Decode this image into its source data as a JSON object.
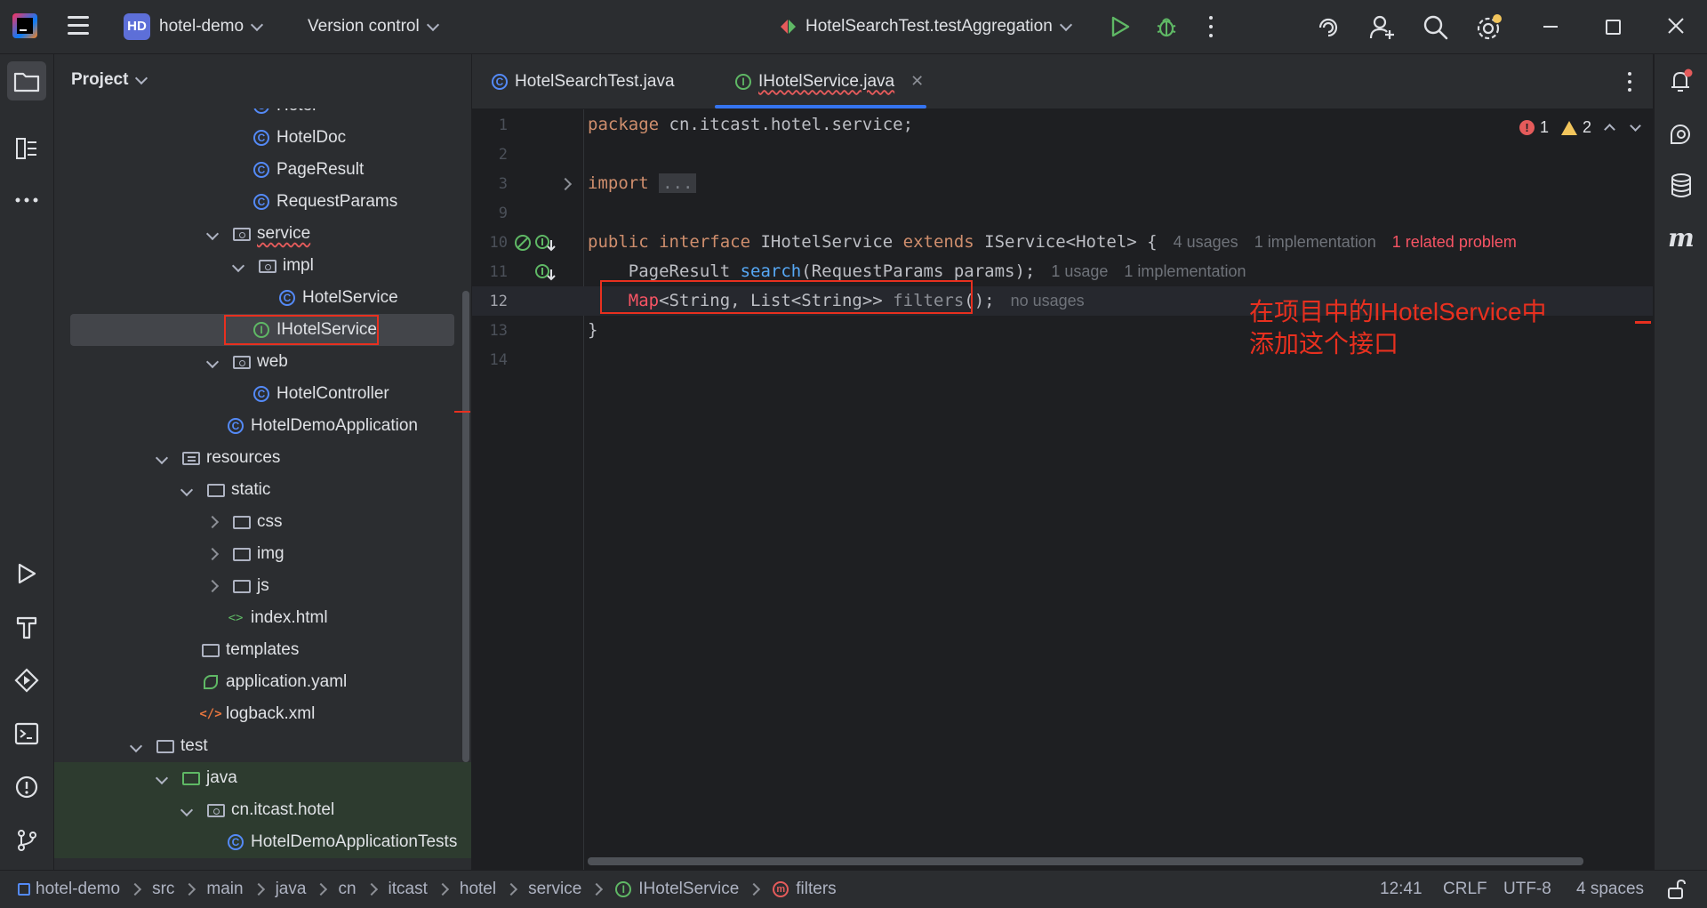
{
  "titlebar": {
    "project_badge": "HD",
    "project_name": "hotel-demo",
    "vcs_label": "Version control",
    "run_config": "HotelSearchTest.testAggregation"
  },
  "project_panel": {
    "title": "Project",
    "rows": [
      {
        "label": "Hotel",
        "icon": "class-icon"
      },
      {
        "label": "HotelDoc",
        "icon": "class-icon"
      },
      {
        "label": "PageResult",
        "icon": "class-icon"
      },
      {
        "label": "RequestParams",
        "icon": "class-icon"
      },
      {
        "label": "service",
        "icon": "package-icon"
      },
      {
        "label": "impl",
        "icon": "package-icon"
      },
      {
        "label": "HotelService",
        "icon": "class-icon"
      },
      {
        "label": "IHotelService",
        "icon": "interface-icon"
      },
      {
        "label": "web",
        "icon": "package-icon"
      },
      {
        "label": "HotelController",
        "icon": "class-icon"
      },
      {
        "label": "HotelDemoApplication",
        "icon": "spring-app-icon"
      },
      {
        "label": "resources",
        "icon": "resources-folder-icon"
      },
      {
        "label": "static",
        "icon": "folder-icon"
      },
      {
        "label": "css",
        "icon": "folder-icon"
      },
      {
        "label": "img",
        "icon": "folder-icon"
      },
      {
        "label": "js",
        "icon": "folder-icon"
      },
      {
        "label": "index.html",
        "icon": "html-icon"
      },
      {
        "label": "templates",
        "icon": "folder-icon"
      },
      {
        "label": "application.yaml",
        "icon": "yaml-icon"
      },
      {
        "label": "logback.xml",
        "icon": "xml-icon"
      },
      {
        "label": "test",
        "icon": "folder-icon"
      },
      {
        "label": "java",
        "icon": "test-folder-icon"
      },
      {
        "label": "cn.itcast.hotel",
        "icon": "package-icon"
      },
      {
        "label": "HotelDemoApplicationTests",
        "icon": "test-class-icon"
      }
    ]
  },
  "tabs": [
    {
      "label": "HotelSearchTest.java"
    },
    {
      "label": "IHotelService.java"
    }
  ],
  "editor": {
    "line_numbers": [
      "1",
      "2",
      "3",
      "9",
      "10",
      "11",
      "12",
      "13",
      "14"
    ],
    "line1": {
      "kw": "package",
      "rest": " cn.itcast.hotel.service;"
    },
    "line3": {
      "kw": "import",
      "folded": "..."
    },
    "line10": {
      "kw1": "public",
      "kw2": "interface",
      "name": " IHotelService ",
      "kw3": "extends",
      "rest": " IService<Hotel> {",
      "hint_usages": "4 usages",
      "hint_impl": "1 implementation",
      "hint_problem": "1 related problem"
    },
    "line11": {
      "type": "PageResult ",
      "method": "search",
      "rest": "(RequestParams params);",
      "hint_usages": "1 usage",
      "hint_impl": "1 implementation"
    },
    "line12": {
      "map": "Map",
      "rest": "<String, List<String>> ",
      "method": "filters",
      "tail": "();",
      "hint_usages": "no usages"
    },
    "line13": "}",
    "inspections": {
      "errors": "1",
      "warnings": "2"
    },
    "annotation": "在项目中的IHotelService中\n添加这个接口"
  },
  "statusbar": {
    "breadcrumbs": [
      "hotel-demo",
      "src",
      "main",
      "java",
      "cn",
      "itcast",
      "hotel",
      "service",
      "IHotelService",
      "filters"
    ],
    "position": "12:41",
    "line_sep": "CRLF",
    "encoding": "UTF-8",
    "indent": "4 spaces"
  },
  "colors": {
    "accent": "#3574f0",
    "annotation_red": "#e8301f",
    "interface_green": "#5fb865",
    "class_blue": "#548af7"
  }
}
